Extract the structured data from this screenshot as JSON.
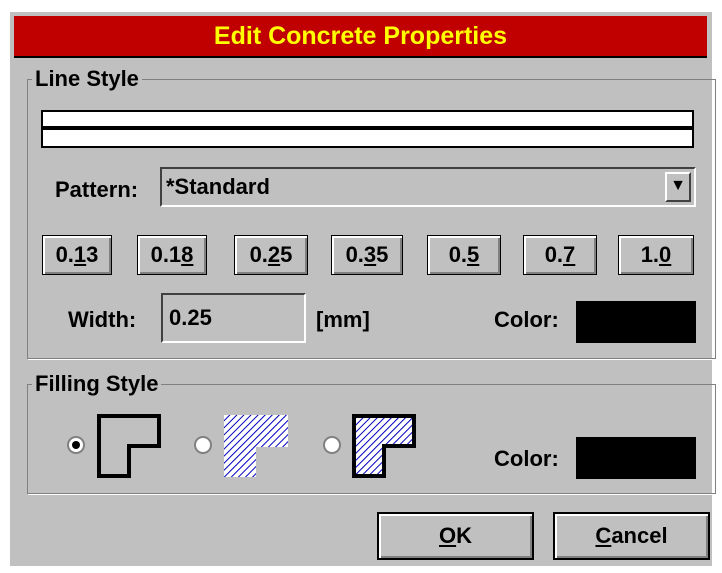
{
  "dialog": {
    "title": "Edit Concrete Properties"
  },
  "line_style": {
    "group_label": "Line Style",
    "pattern_label": "Pattern:",
    "pattern_value": "*Standard",
    "width_buttons": [
      {
        "pre": "0.",
        "ul": "1",
        "post": "3"
      },
      {
        "pre": "0.1",
        "ul": "8",
        "post": ""
      },
      {
        "pre": "0.",
        "ul": "2",
        "post": "5"
      },
      {
        "pre": "0.",
        "ul": "3",
        "post": "5"
      },
      {
        "pre": "0.",
        "ul": "5",
        "post": ""
      },
      {
        "pre": "0.",
        "ul": "7",
        "post": ""
      },
      {
        "pre": "1.",
        "ul": "0",
        "post": ""
      }
    ],
    "width_label": "Width:",
    "width_value": "0.25",
    "unit": "[mm]",
    "color_label": "Color:",
    "color": "#000000"
  },
  "filling_style": {
    "group_label": "Filling Style",
    "selected_option": 0,
    "options": [
      "outline-fill-icon",
      "hatched-fill-icon",
      "hatched-outline-fill-icon"
    ],
    "color_label": "Color:",
    "color": "#000000"
  },
  "buttons": {
    "ok": {
      "ul": "O",
      "rest": "K"
    },
    "cancel": {
      "ul": "C",
      "rest": "ancel"
    }
  },
  "colors": {
    "title_bg": "#c00000",
    "title_fg": "#ffff00",
    "face": "#c0c0c0",
    "hatch": "#0000c0"
  }
}
